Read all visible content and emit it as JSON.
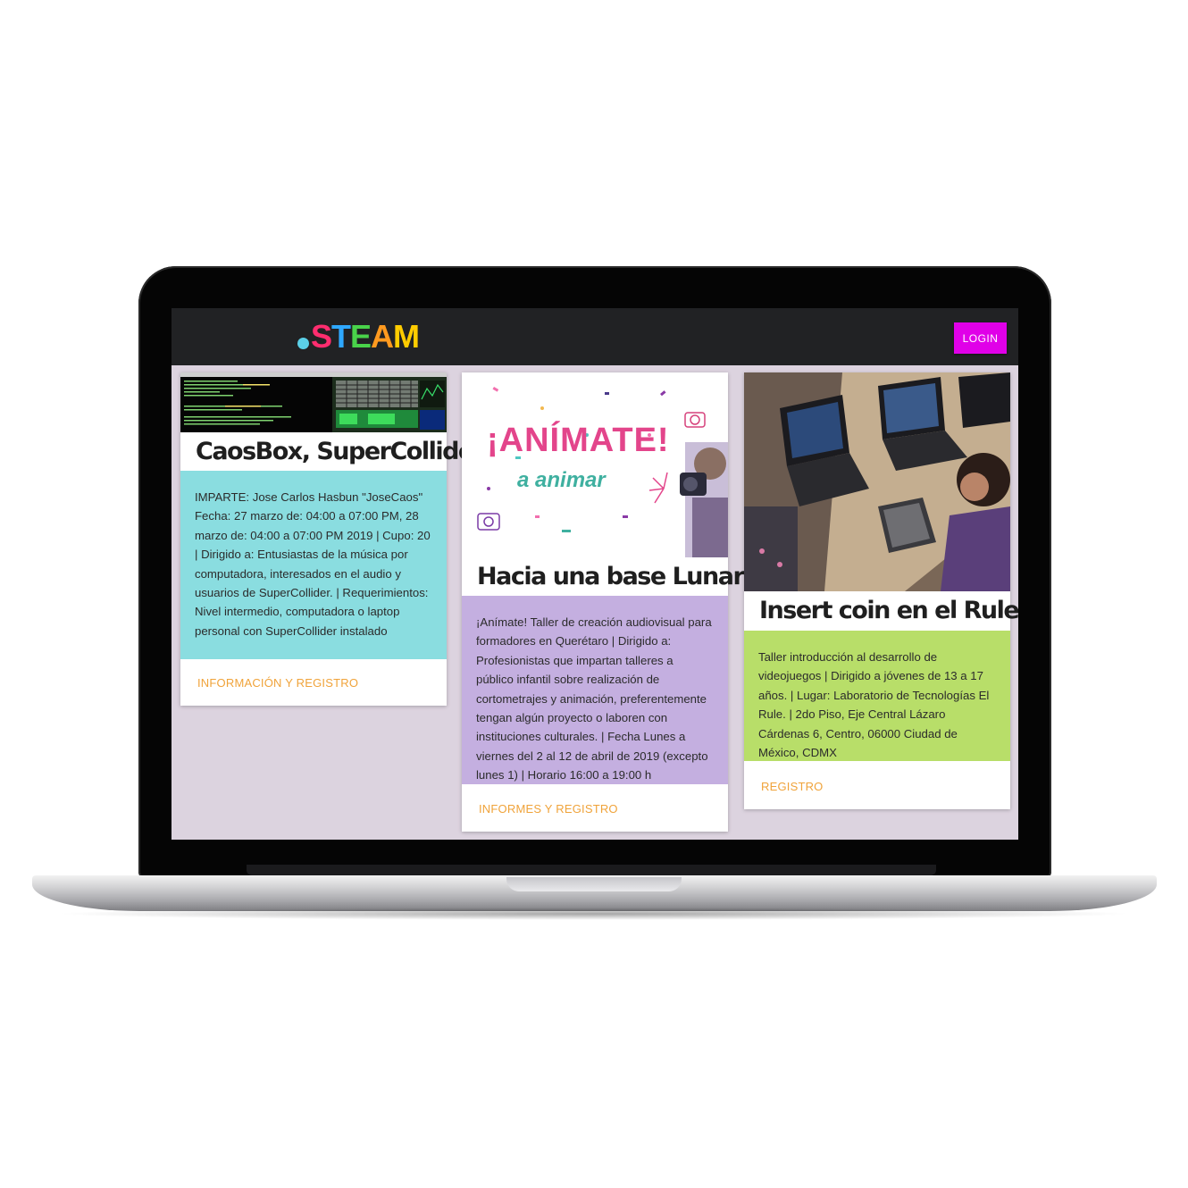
{
  "navbar": {
    "logo_text": ".STEAM",
    "logo_letters": [
      "S",
      "T",
      "E",
      "A",
      "M"
    ],
    "logo_colors": [
      "#ff2d6f",
      "#2fa8ff",
      "#49d34a",
      "#ff9a1f",
      "#ffcc00"
    ],
    "login_label": "LOGIN",
    "login_color": "#e000e8"
  },
  "cards": [
    {
      "image_icon": "code-editor-screenshot",
      "title": "CaosBox, SuperCollider",
      "body": "IMPARTE: Jose Carlos Hasbun \"JoseCaos\" Fecha: 27 marzo de: 04:00 a 07:00 PM, 28 marzo de: 04:00 a 07:00 PM 2019 | Cupo: 20 | Dirigido a: Entusiastas de la música por computadora, interesados en el audio y usuarios de SuperCollider. | Requerimientos: Nivel intermedio, computadora o laptop personal con SuperCollider instalado",
      "link": "INFORMACIÓN Y REGISTRO",
      "body_color": "#8adde0"
    },
    {
      "image_icon": "animate-poster",
      "image_text_1": "¡ANÍMATE!",
      "image_text_2": "a animar",
      "title": "Hacia una base Lunar",
      "body": "¡Anímate! Taller de creación audiovisual para formadores en Querétaro | Dirigido a: Profesionistas que impartan talleres a público infantil sobre realización de cortometrajes y animación, preferentemente tengan algún proyecto o laboren con instituciones culturales. | Fecha Lunes a viernes del 2 al 12 de abril de 2019 (excepto lunes 1) | Horario 16:00 a 19:00 h",
      "link": "INFORMES Y REGISTRO",
      "body_color": "#c4afe0"
    },
    {
      "image_icon": "workshop-photo",
      "title": "Insert coin en el Rule",
      "body": "Taller introducción al desarrollo de videojuegos | Dirigido a jóvenes de 13 a 17 años. | Lugar: Laboratorio de Tecnologías El Rule. | 2do Piso, Eje Central Lázaro Cárdenas 6, Centro, 06000 Ciudad de México, CDMX",
      "link": "REGISTRO",
      "body_color": "#b8de69"
    }
  ],
  "colors": {
    "screen_bg": "#dcd3df",
    "navbar_bg": "#212224",
    "link": "#f0a33a"
  }
}
